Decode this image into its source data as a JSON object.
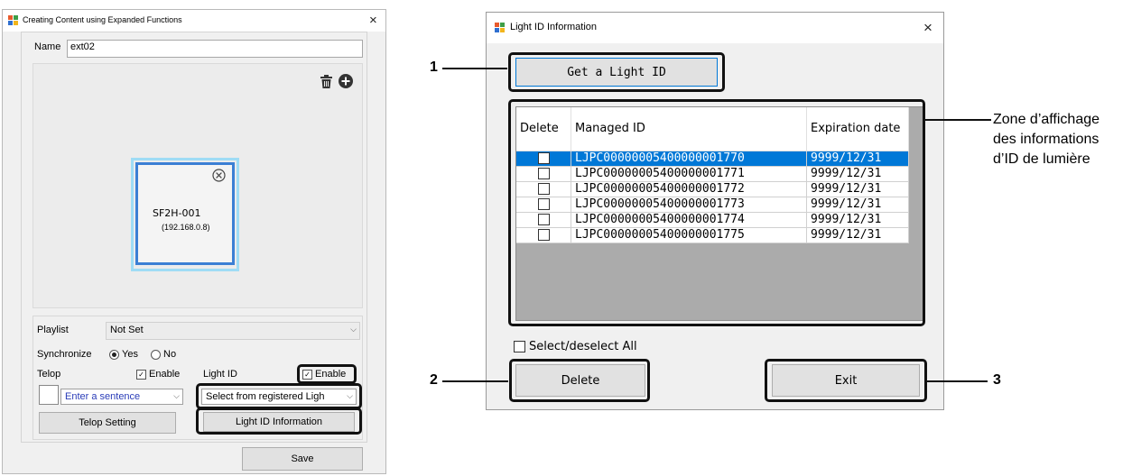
{
  "left_window": {
    "title": "Creating Content using Expanded Functions",
    "close_glyph": "×",
    "name_label": "Name",
    "name_value": "ext02",
    "device": {
      "name": "SF2H-001",
      "ip": "(192.168.0.8)"
    },
    "playlist_label": "Playlist",
    "playlist_value": "Not Set",
    "synchronize_label": "Synchronize",
    "sync_yes": "Yes",
    "sync_no": "No",
    "sync_selected": "Yes",
    "telop_label": "Telop",
    "telop_enable": "Enable",
    "telop_input_placeholder": "Enter a sentence",
    "light_id_label": "Light ID",
    "light_id_enable": "Enable",
    "light_id_select": "Select from registered Ligh",
    "telop_setting_button": "Telop Setting",
    "light_id_info_button": "Light ID Information",
    "save_button": "Save"
  },
  "right_window": {
    "title": "Light ID Information",
    "close_glyph": "×",
    "get_button": "Get a Light ID",
    "columns": [
      "Delete",
      "Managed ID",
      "Expiration date"
    ],
    "rows": [
      {
        "id": "LJPC00000005400000001770",
        "date": "9999/12/31",
        "selected": true
      },
      {
        "id": "LJPC00000005400000001771",
        "date": "9999/12/31",
        "selected": false
      },
      {
        "id": "LJPC00000005400000001772",
        "date": "9999/12/31",
        "selected": false
      },
      {
        "id": "LJPC00000005400000001773",
        "date": "9999/12/31",
        "selected": false
      },
      {
        "id": "LJPC00000005400000001774",
        "date": "9999/12/31",
        "selected": false
      },
      {
        "id": "LJPC00000005400000001775",
        "date": "9999/12/31",
        "selected": false
      }
    ],
    "select_all_label": "Select/deselect All",
    "delete_button": "Delete",
    "exit_button": "Exit"
  },
  "annotations": {
    "n1": "1",
    "n2": "2",
    "n3": "3",
    "zone_line1": "Zone d’affichage",
    "zone_line2": "des informations",
    "zone_line3": "d’ID de lumière"
  },
  "colors": {
    "selection": "#0078d7",
    "device_frame": "#3b7fd4",
    "device_glow": "#9fdcf5",
    "callout": "#111111"
  },
  "icons": [
    "app-icon",
    "close-icon",
    "trash-icon",
    "add-circle-icon",
    "remove-circle-icon",
    "chevron-down-icon"
  ]
}
